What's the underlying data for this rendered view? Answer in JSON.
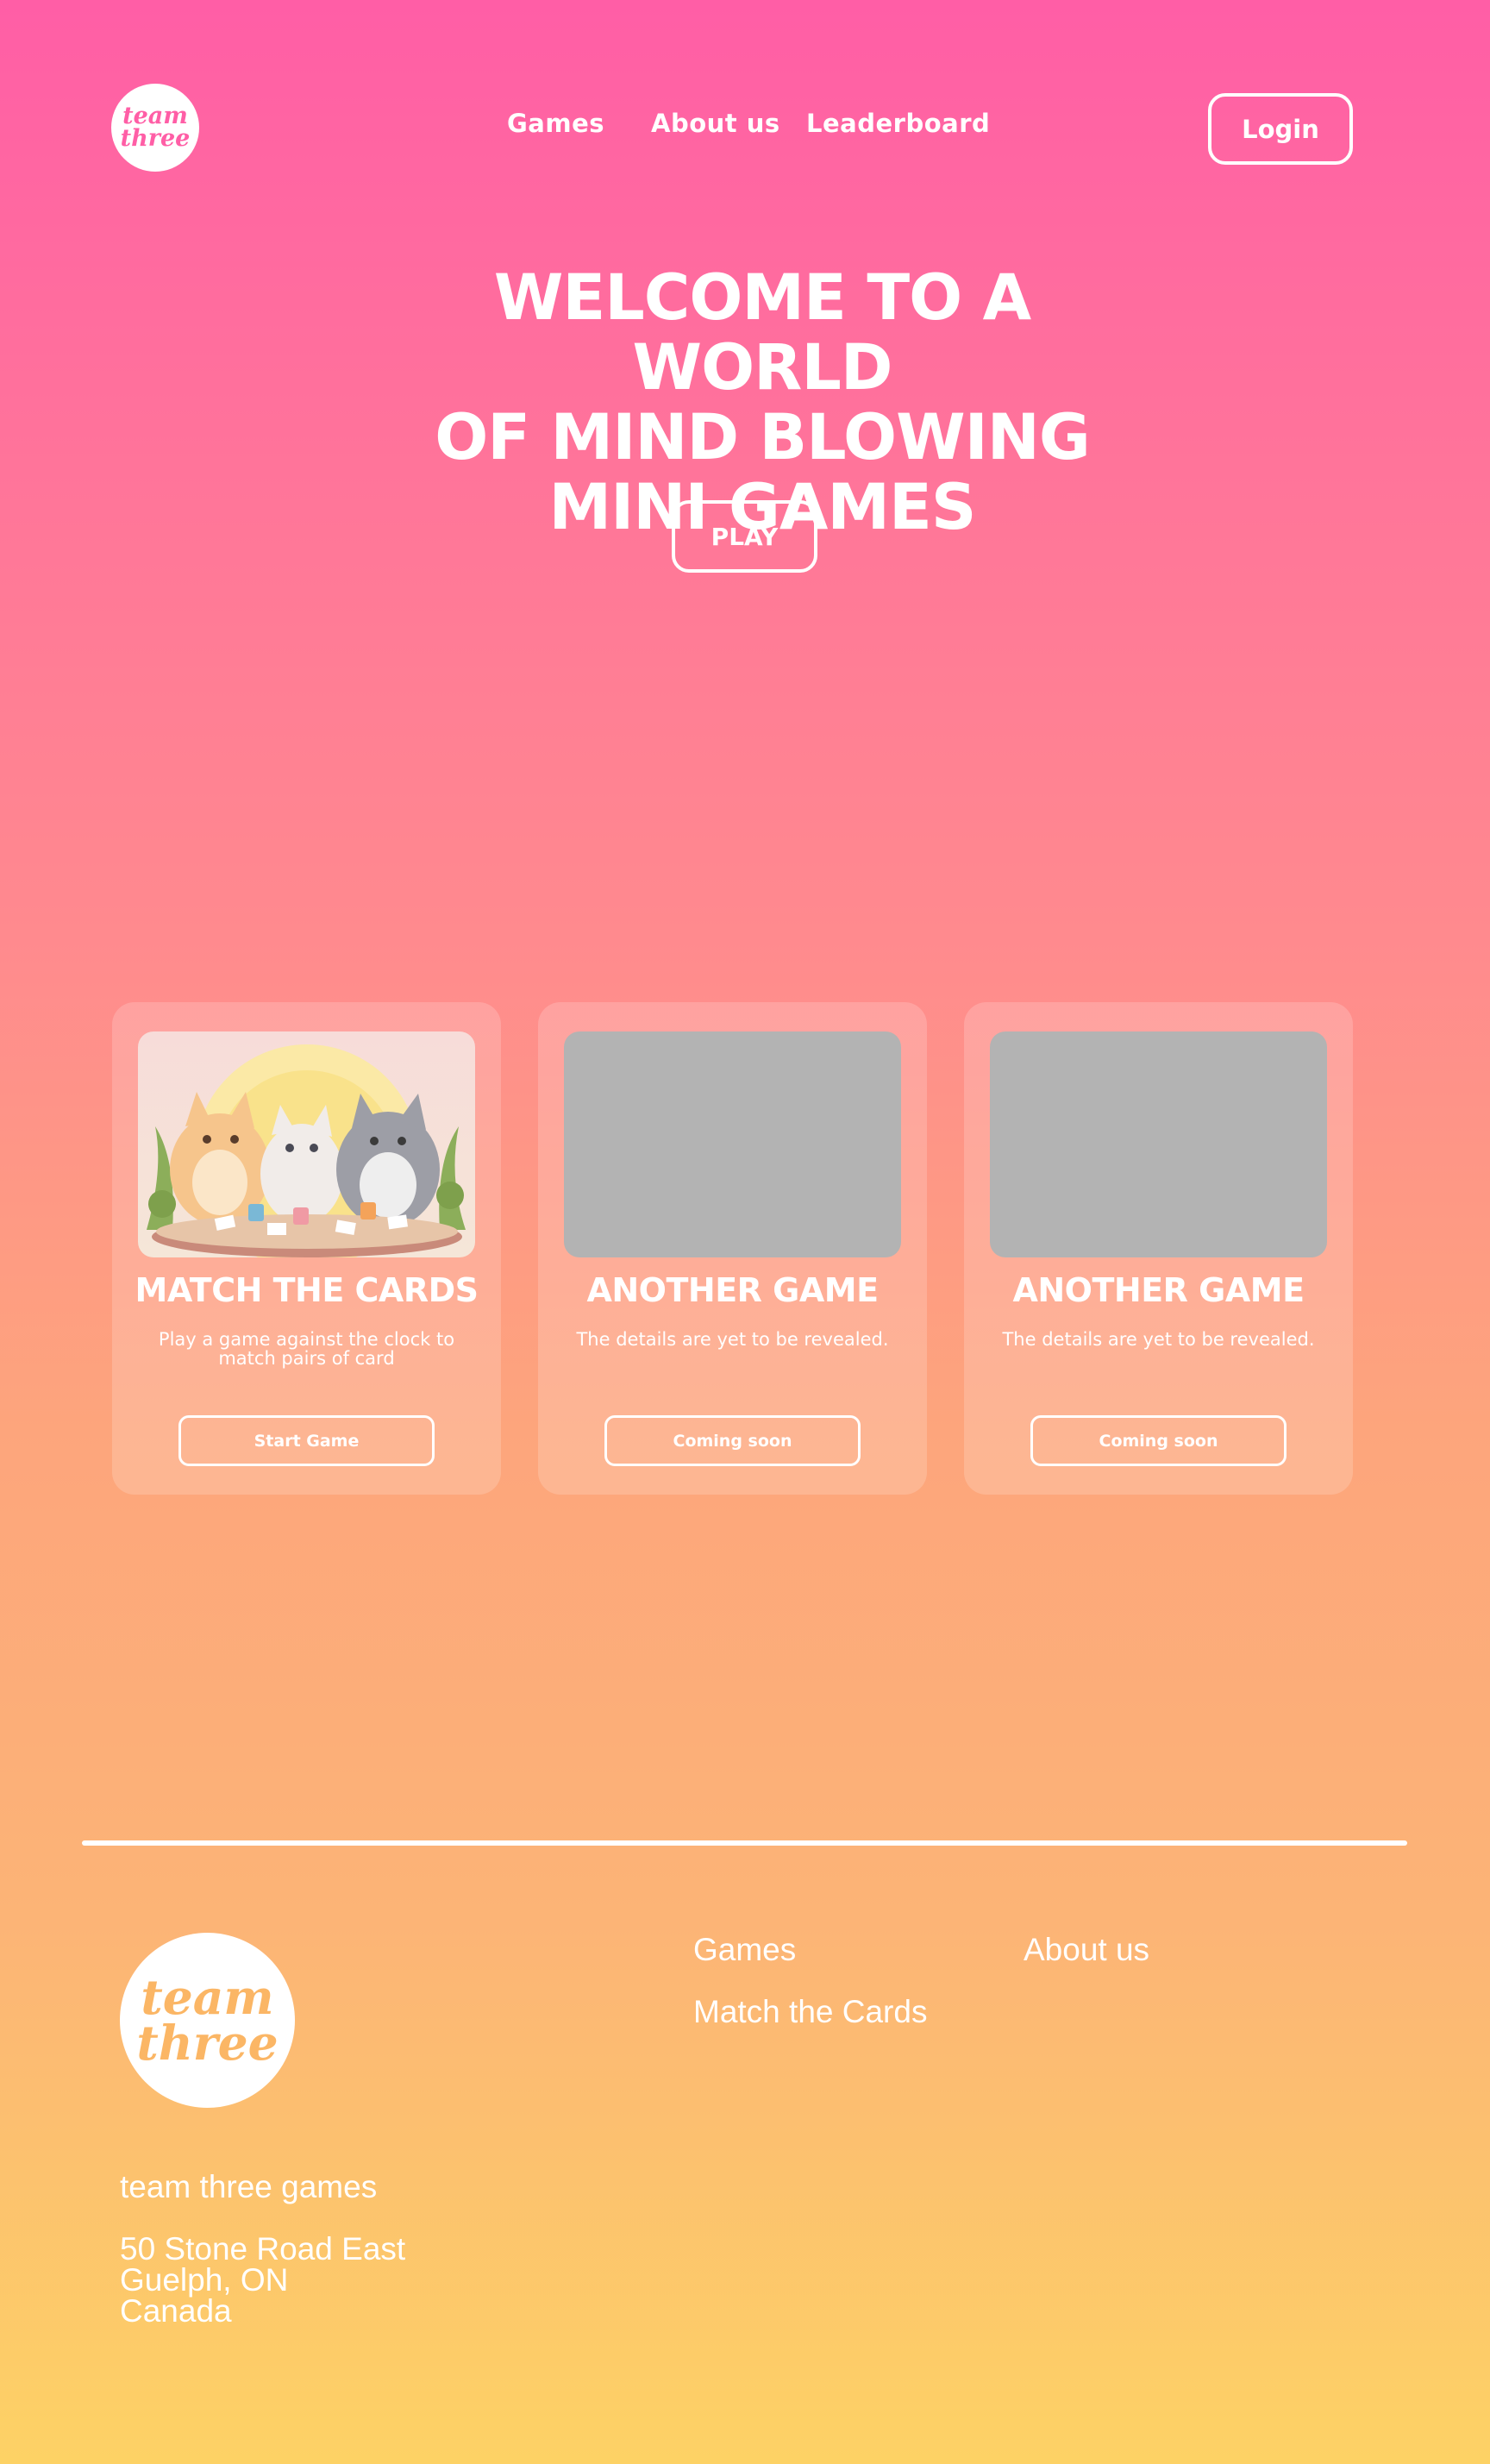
{
  "header": {
    "logo": {
      "line1": "team",
      "line2": "three"
    },
    "nav": [
      "Games",
      "About us",
      "Leaderboard"
    ],
    "login_label": "Login"
  },
  "hero": {
    "title_lines": [
      "WELCOME TO A WORLD",
      "OF MIND BLOWING",
      "MINI GAMES"
    ],
    "play_label": "PLAY"
  },
  "cards": [
    {
      "title": "MATCH THE CARDS",
      "description": "Play a game against the clock to match pairs of card",
      "button": "Start Game",
      "image": "cats-playing-cards-illustration"
    },
    {
      "title": "ANOTHER GAME",
      "description": "The details are yet to be revealed.",
      "button": "Coming soon",
      "image": "gray-placeholder"
    },
    {
      "title": "ANOTHER GAME",
      "description": "The details are yet to be revealed.",
      "button": "Coming soon",
      "image": "gray-placeholder"
    }
  ],
  "footer": {
    "logo": {
      "line1": "team",
      "line2": "three"
    },
    "company_name": "team three games",
    "address": [
      "50 Stone Road East",
      "Guelph, ON",
      "Canada"
    ],
    "links": {
      "games": "Games",
      "match_the_cards": "Match the Cards",
      "about_us": "About us"
    }
  },
  "colors": {
    "gradient_top": "#ff5ea6",
    "gradient_bottom": "#fdd265",
    "placeholder_gray": "#b3b3b3",
    "logo_pink": "#ff5ea6",
    "logo_orange": "#fbb665"
  }
}
